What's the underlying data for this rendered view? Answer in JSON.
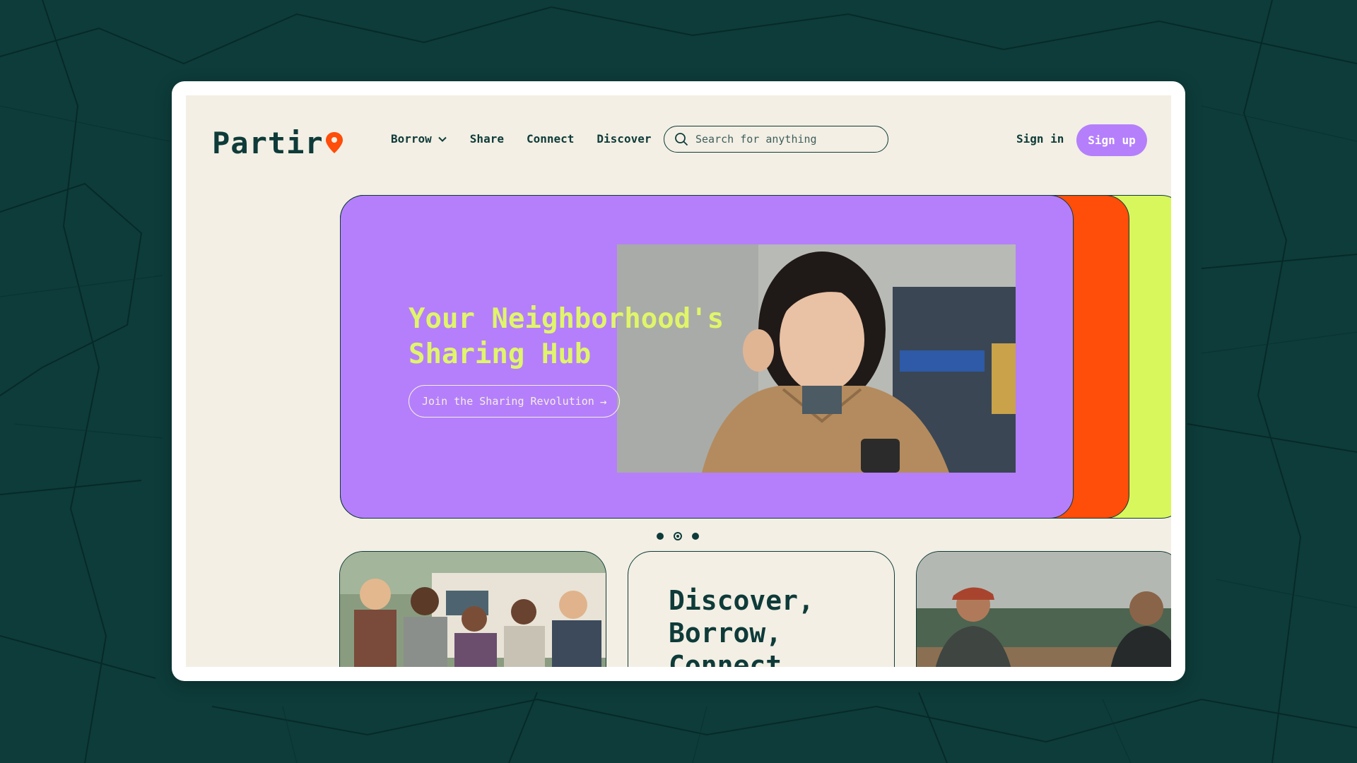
{
  "brand": {
    "name": "Partir",
    "accent": "#ff4d0a"
  },
  "nav": {
    "items": [
      {
        "label": "Borrow",
        "has_dropdown": true
      },
      {
        "label": "Share"
      },
      {
        "label": "Connect"
      },
      {
        "label": "Discover"
      }
    ]
  },
  "search": {
    "placeholder": "Search for anything",
    "value": ""
  },
  "auth": {
    "signin_label": "Sign in",
    "signup_label": "Sign up"
  },
  "hero": {
    "title_line1": "Your Neighborhood's",
    "title_line2": "Sharing Hub",
    "cta_label": "Join the Sharing Revolution",
    "cta_icon": "arrow-right-icon",
    "colors": {
      "slide": "#b57ffb",
      "title": "#e0f56a",
      "back1": "#ff4d0a",
      "back2": "#d8f75c"
    }
  },
  "carousel": {
    "dot_count": 3,
    "active_index": 1
  },
  "cards": {
    "middle_line1": "Discover,",
    "middle_line2": "Borrow,",
    "middle_line3": "Connect"
  },
  "colors": {
    "background": "#0d3c3a",
    "page": "#f3efe4",
    "text": "#0e3b39",
    "signup_bg": "#b57ffb"
  }
}
